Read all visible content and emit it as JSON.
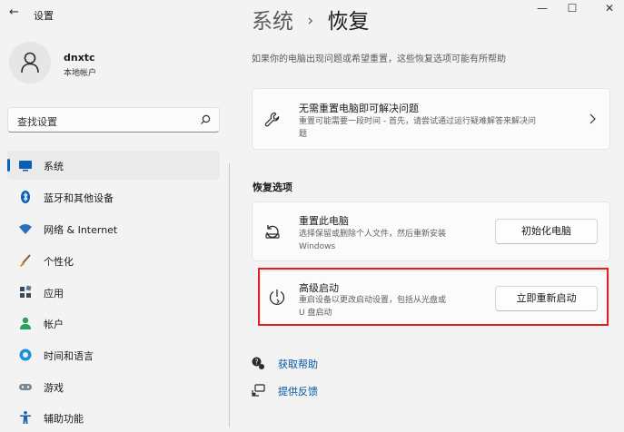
{
  "titlebar": {
    "back_icon": "back-arrow-icon",
    "title": "设置",
    "minimize": "—",
    "maximize": "☐",
    "close": "✕"
  },
  "user": {
    "name": "dnxtc",
    "account_type": "本地帐户"
  },
  "search": {
    "placeholder": "查找设置"
  },
  "sidebar": {
    "items": [
      {
        "label": "系统",
        "icon": "monitor-icon",
        "selected": true
      },
      {
        "label": "蓝牙和其他设备",
        "icon": "bluetooth-icon"
      },
      {
        "label": "网络 & Internet",
        "icon": "wifi-icon"
      },
      {
        "label": "个性化",
        "icon": "brush-icon"
      },
      {
        "label": "应用",
        "icon": "apps-icon"
      },
      {
        "label": "帐户",
        "icon": "person-icon"
      },
      {
        "label": "时间和语言",
        "icon": "globe-clock-icon"
      },
      {
        "label": "游戏",
        "icon": "gamepad-icon"
      },
      {
        "label": "辅助功能",
        "icon": "accessibility-icon"
      }
    ]
  },
  "main": {
    "breadcrumb_parent": "系统",
    "breadcrumb_sep": "›",
    "breadcrumb_current": "恢复",
    "description": "如果你的电脑出现问题或希望重置，这些恢复选项可能有所帮助",
    "troubleshoot": {
      "title": "无需重置电脑即可解决问题",
      "subtitle_line1": "重置可能需要一段时间 - 首先，请尝试通过运行疑难解答来解决问",
      "subtitle_line2": "题"
    },
    "section_title": "恢复选项",
    "reset": {
      "title": "重置此电脑",
      "subtitle_line1": "选择保留或删除个人文件，然后重新安装",
      "subtitle_line2": "Windows",
      "button": "初始化电脑"
    },
    "advanced": {
      "title": "高级启动",
      "subtitle_line1": "重启设备以更改启动设置，包括从光盘或",
      "subtitle_line2": "U 盘启动",
      "button": "立即重新启动"
    },
    "links": {
      "help": "获取帮助",
      "feedback": "提供反馈"
    }
  },
  "colors": {
    "accent": "#0067c0",
    "highlight_border": "#e02020",
    "link": "#0056a6"
  }
}
